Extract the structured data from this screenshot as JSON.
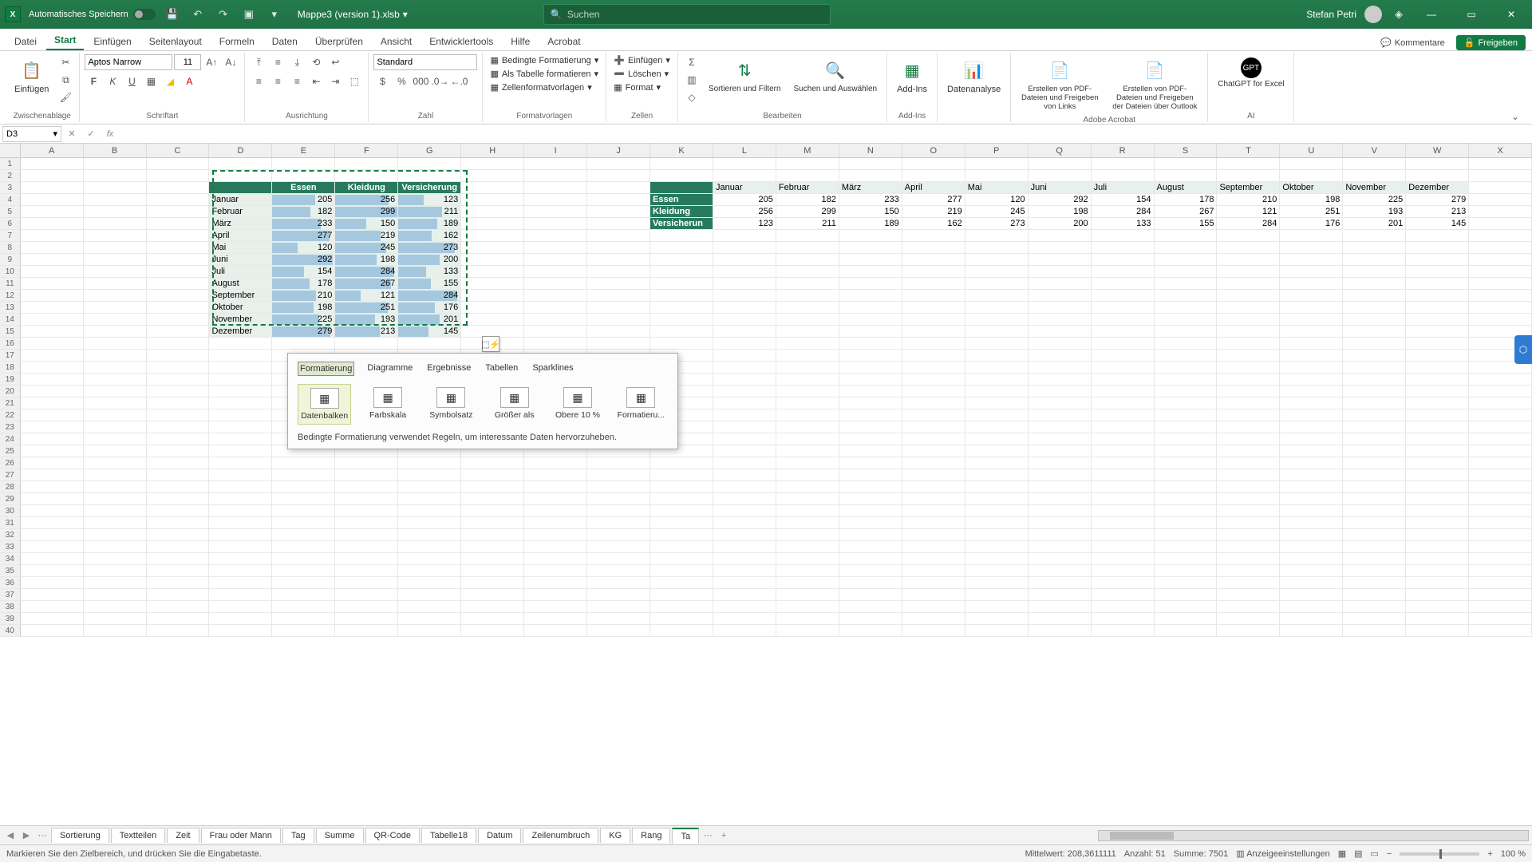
{
  "titlebar": {
    "autosave_label": "Automatisches Speichern",
    "filename": "Mappe3 (version 1).xlsb",
    "search_placeholder": "Suchen",
    "username": "Stefan Petri"
  },
  "ribbon_tabs": [
    "Datei",
    "Start",
    "Einfügen",
    "Seitenlayout",
    "Formeln",
    "Daten",
    "Überprüfen",
    "Ansicht",
    "Entwicklertools",
    "Hilfe",
    "Acrobat"
  ],
  "ribbon_active": "Start",
  "ribbon_right": {
    "comments": "Kommentare",
    "share": "Freigeben"
  },
  "ribbon": {
    "clipboard": {
      "paste": "Einfügen",
      "group": "Zwischenablage"
    },
    "font": {
      "name": "Aptos Narrow",
      "size": "11",
      "group": "Schriftart",
      "bold": "F",
      "italic": "K",
      "underline": "U"
    },
    "align": {
      "group": "Ausrichtung"
    },
    "number": {
      "format": "Standard",
      "group": "Zahl"
    },
    "styles": {
      "cond": "Bedingte Formatierung",
      "table": "Als Tabelle formatieren",
      "cell": "Zellenformatvorlagen",
      "group": "Formatvorlagen"
    },
    "cells": {
      "insert": "Einfügen",
      "delete": "Löschen",
      "format": "Format",
      "group": "Zellen"
    },
    "editing": {
      "sort": "Sortieren und Filtern",
      "find": "Suchen und Auswählen",
      "group": "Bearbeiten"
    },
    "addins": {
      "btn": "Add-Ins",
      "group": "Add-Ins"
    },
    "analyze": {
      "btn": "Datenanalyse"
    },
    "acrobat": {
      "pdf1": "Erstellen von PDF-Dateien und Freigeben von Links",
      "pdf2": "Erstellen von PDF-Dateien und Freigeben der Dateien über Outlook",
      "group": "Adobe Acrobat"
    },
    "ai": {
      "btn": "ChatGPT for Excel",
      "group": "AI"
    }
  },
  "name_box": "D3",
  "columns": [
    "A",
    "B",
    "C",
    "D",
    "E",
    "F",
    "G",
    "H",
    "I",
    "J",
    "K",
    "L",
    "M",
    "N",
    "O",
    "P",
    "Q",
    "R",
    "S",
    "T",
    "U",
    "V",
    "W",
    "X"
  ],
  "table1": {
    "headers": [
      "",
      "Essen",
      "Kleidung",
      "Versicherung"
    ],
    "rows": [
      [
        "Januar",
        205,
        256,
        123
      ],
      [
        "Februar",
        182,
        299,
        211
      ],
      [
        "März",
        233,
        150,
        189
      ],
      [
        "April",
        277,
        219,
        162
      ],
      [
        "Mai",
        120,
        245,
        273
      ],
      [
        "Juni",
        292,
        198,
        200
      ],
      [
        "Juli",
        154,
        284,
        133
      ],
      [
        "August",
        178,
        267,
        155
      ],
      [
        "September",
        210,
        121,
        284
      ],
      [
        "Oktober",
        198,
        251,
        176
      ],
      [
        "November",
        225,
        193,
        201
      ],
      [
        "Dezember",
        279,
        213,
        145
      ]
    ],
    "max": 300
  },
  "table2": {
    "row_headers": [
      "",
      "Essen",
      "Kleidung",
      "Versicherun"
    ],
    "col_headers": [
      "Januar",
      "Februar",
      "März",
      "April",
      "Mai",
      "Juni",
      "Juli",
      "August",
      "September",
      "Oktober",
      "November",
      "Dezember"
    ],
    "data": [
      [
        205,
        182,
        233,
        277,
        120,
        292,
        154,
        178,
        210,
        198,
        225,
        279
      ],
      [
        256,
        299,
        150,
        219,
        245,
        198,
        284,
        267,
        121,
        251,
        193,
        213
      ],
      [
        123,
        211,
        189,
        162,
        273,
        200,
        133,
        155,
        284,
        176,
        201,
        145
      ]
    ]
  },
  "qa": {
    "tabs": [
      "Formatierung",
      "Diagramme",
      "Ergebnisse",
      "Tabellen",
      "Sparklines"
    ],
    "active_tab": "Formatierung",
    "options": [
      "Datenbalken",
      "Farbskala",
      "Symbolsatz",
      "Größer als",
      "Obere 10 %",
      "Formatieru..."
    ],
    "selected": "Datenbalken",
    "desc": "Bedingte Formatierung verwendet Regeln, um interessante Daten hervorzuheben."
  },
  "sheet_tabs": [
    "Sortierung",
    "Textteilen",
    "Zeit",
    "Frau oder Mann",
    "Tag",
    "Summe",
    "QR-Code",
    "Tabelle18",
    "Datum",
    "Zeilenumbruch",
    "KG",
    "Rang",
    "Ta"
  ],
  "status": {
    "hint": "Markieren Sie den Zielbereich, und drücken Sie die Eingabetaste.",
    "avg_label": "Mittelwert:",
    "avg": "208,3611111",
    "count_label": "Anzahl:",
    "count": "51",
    "sum_label": "Summe:",
    "sum": "7501",
    "display": "Anzeigeeinstellungen",
    "zoom": "100 %"
  }
}
